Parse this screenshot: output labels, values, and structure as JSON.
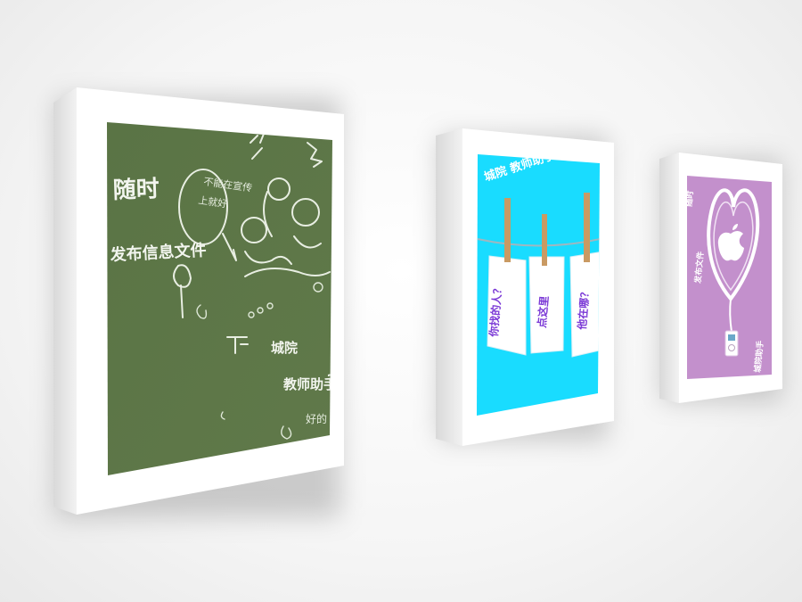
{
  "panel1": {
    "heading": "随时",
    "line1": "发布信息文件",
    "line2": "城院",
    "line3": "教师助手",
    "question_mark": "?",
    "scribble_a": "不能在宣传",
    "scribble_b": "上就好",
    "scribble_c": "好的",
    "colors": {
      "board": "#5d7648",
      "frame": "#ffffff",
      "chalk": "#eef2ea"
    }
  },
  "panel2": {
    "header": "城院 教师助手",
    "card1": "你找的人？",
    "card2": "点这里",
    "card3": "他在哪？",
    "colors": {
      "background": "#19dcff",
      "card": "#ffffff",
      "card_text": "#7b39d6",
      "peg": "#c99a63"
    }
  },
  "panel3": {
    "left_top": "随时",
    "left_mid": "发布文件",
    "bottom_right": "城院助手",
    "colors": {
      "background": "#c390cc",
      "heart": "#ffffff"
    },
    "icon": "apple-icon"
  }
}
